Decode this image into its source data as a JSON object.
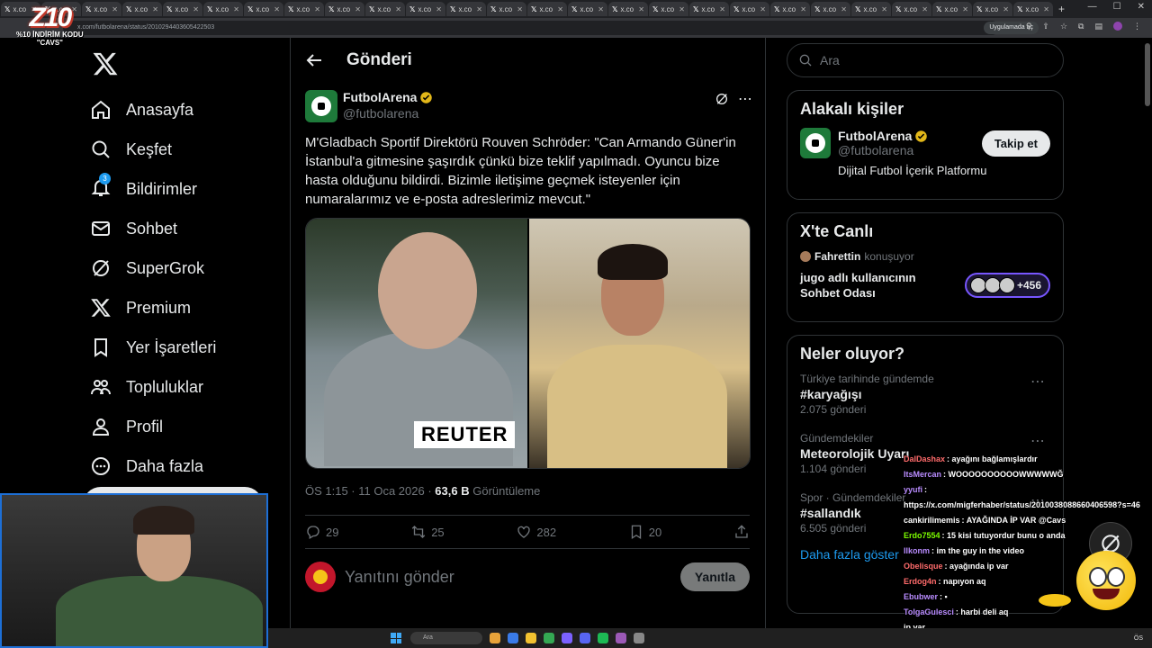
{
  "browser": {
    "tab_label": "x.co",
    "tab_count": 26,
    "url": "x.com/futbolarena/status/2010294403605422503",
    "open_app_label": "Uygulamada aç"
  },
  "overlay_logo": {
    "big": "Z10",
    "line1": "%10 İNDİRİM KODU",
    "line2": "\"CAVS\""
  },
  "nav": {
    "items": [
      {
        "label": "Anasayfa",
        "icon": "home-icon"
      },
      {
        "label": "Keşfet",
        "icon": "search-icon"
      },
      {
        "label": "Bildirimler",
        "icon": "bell-icon",
        "badge": "3"
      },
      {
        "label": "Sohbet",
        "icon": "mail-icon"
      },
      {
        "label": "SuperGrok",
        "icon": "grok-icon"
      },
      {
        "label": "Premium",
        "icon": "x-icon"
      },
      {
        "label": "Yer İşaretleri",
        "icon": "bookmark-icon"
      },
      {
        "label": "Topluluklar",
        "icon": "communities-icon"
      },
      {
        "label": "Profil",
        "icon": "profile-icon"
      },
      {
        "label": "Daha fazla",
        "icon": "more-icon"
      }
    ]
  },
  "post": {
    "header_title": "Gönderi",
    "author_name": "FutbolArena",
    "author_handle": "@futbolarena",
    "text": "M'Gladbach Sportif Direktörü Rouven Schröder: \"Can Armando Güner'in İstanbul'a gitmesine şaşırdık çünkü bize teklif yapılmadı. Oyuncu bize hasta olduğunu bildirdi. Bizimle iletişime geçmek isteyenler için numaralarımız ve e-posta adreslerimiz mevcut.\"",
    "image_sign_text": "REUTER",
    "time": "ÖS 1:15 · 11 Oca 2026 · ",
    "views": "63,6 B",
    "views_label": " Görüntüleme",
    "replies": "29",
    "reposts": "25",
    "likes": "282",
    "bookmarks": "20",
    "reply_placeholder": "Yanıtını gönder",
    "reply_button": "Yanıtla"
  },
  "right": {
    "search_placeholder": "Ara",
    "related": {
      "title": "Alakalı kişiler",
      "name": "FutbolArena",
      "handle": "@futbolarena",
      "follow": "Takip et",
      "bio": "Dijital Futbol İçerik Platformu"
    },
    "live": {
      "title": "X'te Canlı",
      "host": "Fahrettin",
      "host_suffix": "konuşuyor",
      "room_line1": "jugo adlı kullanıcının",
      "room_line2": "Sohbet Odası",
      "listeners": "+456"
    },
    "trends": {
      "title": "Neler oluyor?",
      "items": [
        {
          "context": "Türkiye tarihinde gündemde",
          "topic": "#karyağışı",
          "count": "2.075 gönderi"
        },
        {
          "context": "Gündemdekiler",
          "topic": "Meteorolojik Uyarı",
          "count": "1.104 gönderi"
        },
        {
          "context": "Spor · Gündemdekiler",
          "topic": "#sallandık",
          "count": "6.505 gönderi"
        }
      ],
      "show_more": "Daha fazla göster"
    }
  },
  "chat": [
    {
      "user": "DalDashax",
      "color": "#ff6b6b",
      "msg": ": ayağını bağlamışlardır"
    },
    {
      "user": "ItsMercan",
      "color": "#b98cff",
      "msg": ": WOOOOOOOOOOWWWWWĞ"
    },
    {
      "user": "yyufi",
      "color": "#b98cff",
      "msg": ":"
    },
    {
      "user": "",
      "color": "#ffffff",
      "msg": "https://x.com/migferhaber/status/2010038088660406598?s=46"
    },
    {
      "user": "cankirilimemis",
      "color": "#ffffff",
      "msg": ": AYAĞINDA İP VAR @Cavs"
    },
    {
      "user": "Erdo7554",
      "color": "#7CFC00",
      "msg": ": 15 kisi tutuyordur bunu o anda"
    },
    {
      "user": "Ilkonm",
      "color": "#b98cff",
      "msg": ": im the guy in the video"
    },
    {
      "user": "Obelisque",
      "color": "#ff6b6b",
      "msg": ": ayağında ip var"
    },
    {
      "user": "Erdog4n",
      "color": "#ff6b6b",
      "msg": ": napıyon aq"
    },
    {
      "user": "Ebubwer",
      "color": "#b98cff",
      "msg": ": ▪"
    },
    {
      "user": "TolgaGulesci",
      "color": "#b98cff",
      "msg": ": harbi deli aq"
    },
    {
      "user": "",
      "color": "#ffffff",
      "msg": "ip var"
    }
  ],
  "taskbar": {
    "search_label": "Ara",
    "clock": "ÖS"
  },
  "colors": {
    "accent": "#1d9bf0",
    "background": "#000000",
    "border": "#2f3336",
    "muted": "#71767b",
    "live_purple": "#7856ff"
  }
}
